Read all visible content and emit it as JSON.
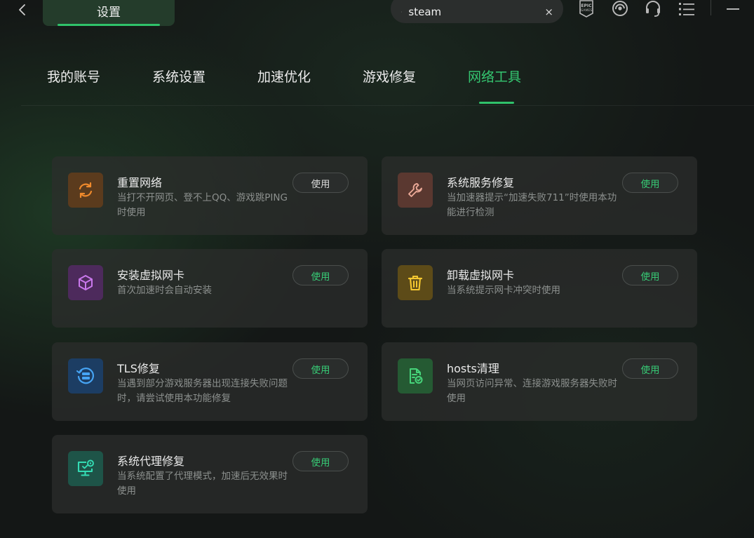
{
  "window": {
    "title": "设置",
    "search": {
      "value": "steam",
      "clear": "×"
    },
    "top_icons": [
      "epic-games-icon",
      "ubisoft-icon",
      "headset-support-icon",
      "list-menu-icon",
      "minimize-icon"
    ]
  },
  "tabs": [
    {
      "label": "我的账号",
      "active": false
    },
    {
      "label": "系统设置",
      "active": false
    },
    {
      "label": "加速优化",
      "active": false
    },
    {
      "label": "游戏修复",
      "active": false
    },
    {
      "label": "网络工具",
      "active": true
    }
  ],
  "cards": [
    {
      "title": "重置网络",
      "desc": "当打不开网页、登不上QQ、游戏跳PING时使用",
      "button": "使用",
      "icon": "refresh-icon",
      "icon_color": "#f08a2c",
      "button_style": "gray"
    },
    {
      "title": "系统服务修复",
      "desc": "当加速器提示“加速失败711”时使用本功能进行检测",
      "button": "使用",
      "icon": "wrench-icon",
      "icon_color": "#e8a090",
      "button_style": "green"
    },
    {
      "title": "安装虚拟网卡",
      "desc": "首次加速时会自动安装",
      "button": "使用",
      "icon": "cube-icon",
      "icon_color": "#c26ee8",
      "button_style": "green"
    },
    {
      "title": "卸载虚拟网卡",
      "desc": "当系统提示网卡冲突时使用",
      "button": "使用",
      "icon": "trash-icon",
      "icon_color": "#f2c52e",
      "button_style": "green"
    },
    {
      "title": "TLS修复",
      "desc": "当遇到部分游戏服务器出现连接失败问题时，请尝试使用本功能修复",
      "button": "使用",
      "icon": "server-icon",
      "icon_color": "#3d9cf0",
      "button_style": "green"
    },
    {
      "title": "hosts清理",
      "desc": "当网页访问异常、连接游戏服务器失败时使用",
      "button": "使用",
      "icon": "file-check-icon",
      "icon_color": "#3fcf72",
      "button_style": "green"
    },
    {
      "title": "系统代理修复",
      "desc": "当系统配置了代理模式，加速后无效果时使用",
      "button": "使用",
      "icon": "monitor-icon",
      "icon_color": "#2fd6b0",
      "button_style": "green"
    }
  ]
}
